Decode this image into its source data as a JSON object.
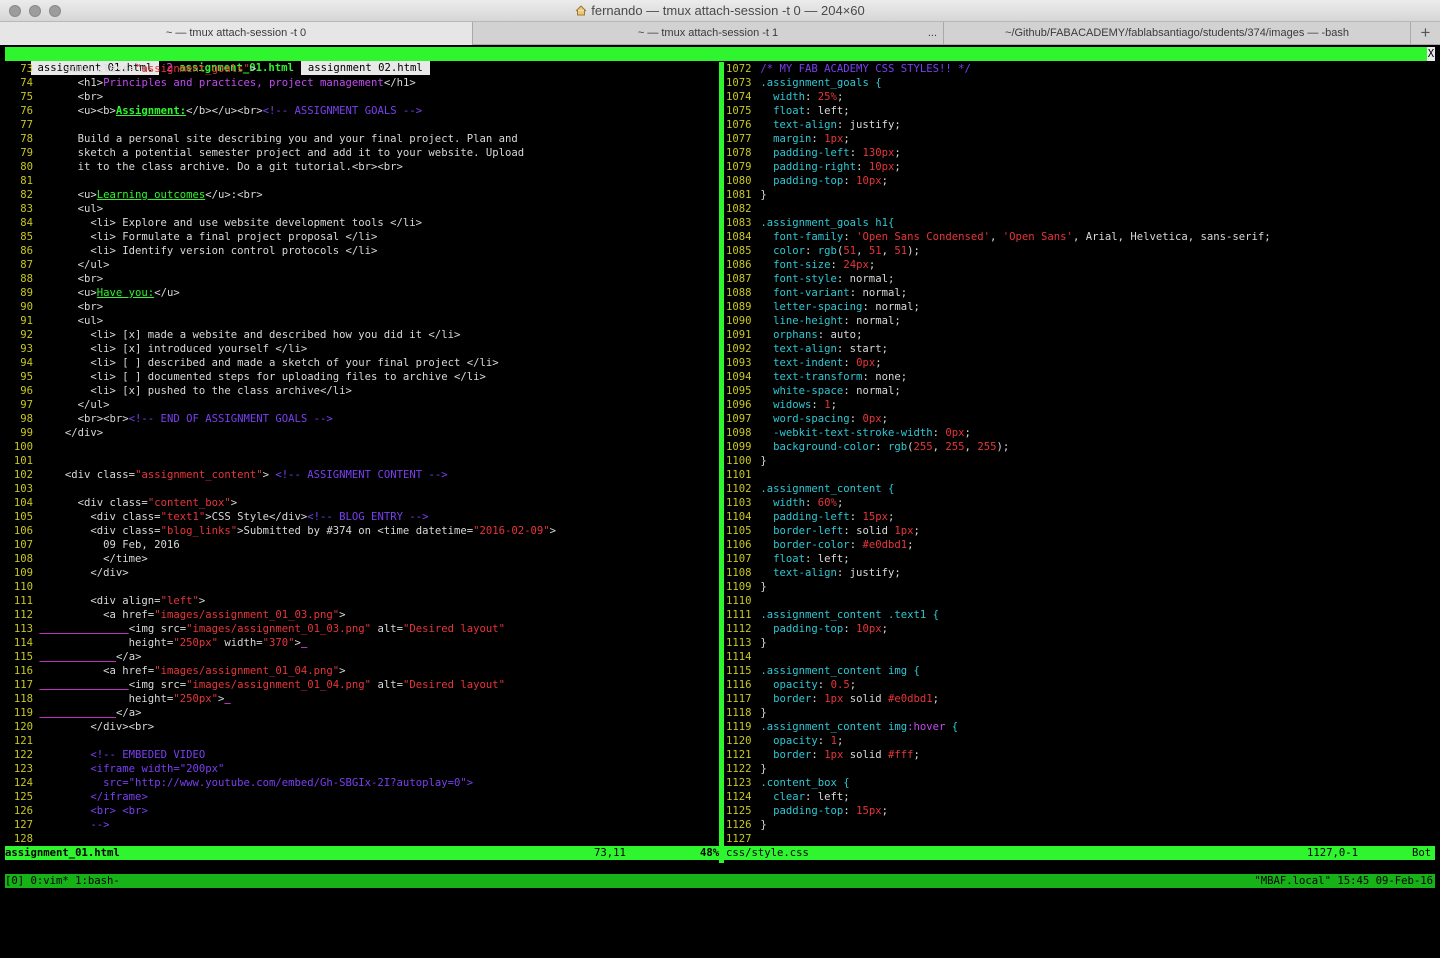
{
  "window": {
    "title": "fernando — tmux attach-session -t 0 — 204×60"
  },
  "tabs": [
    {
      "label": "~ — tmux attach-session -t 0",
      "active": true
    },
    {
      "label": "~ — tmux attach-session -t 1",
      "active": false,
      "extra": "..."
    },
    {
      "label": "~/Github/FABACADEMY/fablabsantiago/students/374/images — -bash",
      "active": false
    }
  ],
  "tab_add": "+",
  "buffers": [
    {
      "label": "assignment 01.html",
      "selected": false
    },
    {
      "num": "2",
      "label": "assignment_01.html",
      "selected": true
    },
    {
      "label": "assignment 02.html",
      "selected": false
    }
  ],
  "buffer_close": "X",
  "left_lines": [
    {
      "n": "73",
      "t": "    <div class=\"assignment_goals\">"
    },
    {
      "n": "74",
      "t": "      <h1>Principles and practices, project management</h1>"
    },
    {
      "n": "75",
      "t": "      <br>"
    },
    {
      "n": "76",
      "t": "      <u><b>Assignment:</b></u><br><!-- ASSIGNMENT GOALS -->"
    },
    {
      "n": "77",
      "t": ""
    },
    {
      "n": "78",
      "t": "      Build a personal site describing you and your final project. Plan and"
    },
    {
      "n": "79",
      "t": "      sketch a potential semester project and add it to your website. Upload"
    },
    {
      "n": "80",
      "t": "      it to the class archive. Do a git tutorial.<br><br>"
    },
    {
      "n": "81",
      "t": ""
    },
    {
      "n": "82",
      "t": "      <u>Learning outcomes</u>:<br>"
    },
    {
      "n": "83",
      "t": "      <ul>"
    },
    {
      "n": "84",
      "t": "        <li> Explore and use website development tools </li>"
    },
    {
      "n": "85",
      "t": "        <li> Formulate a final project proposal </li>"
    },
    {
      "n": "86",
      "t": "        <li> Identify version control protocols </li>"
    },
    {
      "n": "87",
      "t": "      </ul>"
    },
    {
      "n": "88",
      "t": "      <br>"
    },
    {
      "n": "89",
      "t": "      <u>Have you:</u>"
    },
    {
      "n": "90",
      "t": "      <br>"
    },
    {
      "n": "91",
      "t": "      <ul>"
    },
    {
      "n": "92",
      "t": "        <li> [x] made a website and described how you did it </li>"
    },
    {
      "n": "93",
      "t": "        <li> [x] introduced yourself </li>"
    },
    {
      "n": "94",
      "t": "        <li> [ ] described and made a sketch of your final project </li>"
    },
    {
      "n": "95",
      "t": "        <li> [ ] documented steps for uploading files to archive </li>"
    },
    {
      "n": "96",
      "t": "        <li> [x] pushed to the class archive</li>"
    },
    {
      "n": "97",
      "t": "      </ul>"
    },
    {
      "n": "98",
      "t": "      <br><br><!-- END OF ASSIGNMENT GOALS -->"
    },
    {
      "n": "99",
      "t": "    </div>"
    },
    {
      "n": "100",
      "t": ""
    },
    {
      "n": "101",
      "t": ""
    },
    {
      "n": "102",
      "t": "    <div class=\"assignment_content\"> <!-- ASSIGNMENT CONTENT -->"
    },
    {
      "n": "103",
      "t": ""
    },
    {
      "n": "104",
      "t": "      <div class=\"content_box\">"
    },
    {
      "n": "105",
      "t": "        <div class=\"text1\">CSS Style</div><!-- BLOG ENTRY -->"
    },
    {
      "n": "106",
      "t": "        <div class=\"blog_links\">Submitted by #374 on <time datetime=\"2016-02-09\">"
    },
    {
      "n": "107",
      "t": "          09 Feb, 2016"
    },
    {
      "n": "108",
      "t": "          </time>"
    },
    {
      "n": "109",
      "t": "        </div>"
    },
    {
      "n": "110",
      "t": ""
    },
    {
      "n": "111",
      "t": "        <div align=\"left\">"
    },
    {
      "n": "112",
      "t": "          <a href=\"images/assignment_01_03.png\">"
    },
    {
      "n": "113",
      "t": "______________<img src=\"images/assignment_01_03.png\" alt=\"Desired layout\""
    },
    {
      "n": "114",
      "t": "              height=\"250px\" width=\"370\">_"
    },
    {
      "n": "115",
      "t": "____________</a>"
    },
    {
      "n": "116",
      "t": "          <a href=\"images/assignment_01_04.png\">"
    },
    {
      "n": "117",
      "t": "______________<img src=\"images/assignment_01_04.png\" alt=\"Desired layout\""
    },
    {
      "n": "118",
      "t": "              height=\"250px\">_"
    },
    {
      "n": "119",
      "t": "____________</a>"
    },
    {
      "n": "120",
      "t": "        </div><br>"
    },
    {
      "n": "121",
      "t": ""
    },
    {
      "n": "122",
      "t": "        <!-- EMBEDED VIDEO"
    },
    {
      "n": "123",
      "t": "        <iframe width=\"200px\""
    },
    {
      "n": "124",
      "t": "          src=\"http://www.youtube.com/embed/Gh-SBGIx-2I?autoplay=0\">"
    },
    {
      "n": "125",
      "t": "        </iframe>"
    },
    {
      "n": "126",
      "t": "        <br> <br>"
    },
    {
      "n": "127",
      "t": "        -->"
    },
    {
      "n": "128",
      "t": ""
    }
  ],
  "right_lines": [
    {
      "n": "1072",
      "t": "/* MY FAB ACADEMY CSS STYLES!! */"
    },
    {
      "n": "1073",
      "t": ".assignment_goals {"
    },
    {
      "n": "1074",
      "t": "  width: 25%;"
    },
    {
      "n": "1075",
      "t": "  float: left;"
    },
    {
      "n": "1076",
      "t": "  text-align: justify;"
    },
    {
      "n": "1077",
      "t": "  margin: 1px;"
    },
    {
      "n": "1078",
      "t": "  padding-left: 130px;"
    },
    {
      "n": "1079",
      "t": "  padding-right: 10px;"
    },
    {
      "n": "1080",
      "t": "  padding-top: 10px;"
    },
    {
      "n": "1081",
      "t": "}"
    },
    {
      "n": "1082",
      "t": ""
    },
    {
      "n": "1083",
      "t": ".assignment_goals h1{"
    },
    {
      "n": "1084",
      "t": "  font-family: 'Open Sans Condensed', 'Open Sans', Arial, Helvetica, sans-serif;"
    },
    {
      "n": "1085",
      "t": "  color: rgb(51, 51, 51);"
    },
    {
      "n": "1086",
      "t": "  font-size: 24px;"
    },
    {
      "n": "1087",
      "t": "  font-style: normal;"
    },
    {
      "n": "1088",
      "t": "  font-variant: normal;"
    },
    {
      "n": "1089",
      "t": "  letter-spacing: normal;"
    },
    {
      "n": "1090",
      "t": "  line-height: normal;"
    },
    {
      "n": "1091",
      "t": "  orphans: auto;"
    },
    {
      "n": "1092",
      "t": "  text-align: start;"
    },
    {
      "n": "1093",
      "t": "  text-indent: 0px;"
    },
    {
      "n": "1094",
      "t": "  text-transform: none;"
    },
    {
      "n": "1095",
      "t": "  white-space: normal;"
    },
    {
      "n": "1096",
      "t": "  widows: 1;"
    },
    {
      "n": "1097",
      "t": "  word-spacing: 0px;"
    },
    {
      "n": "1098",
      "t": "  -webkit-text-stroke-width: 0px;"
    },
    {
      "n": "1099",
      "t": "  background-color: rgb(255, 255, 255);"
    },
    {
      "n": "1100",
      "t": "}"
    },
    {
      "n": "1101",
      "t": ""
    },
    {
      "n": "1102",
      "t": ".assignment_content {"
    },
    {
      "n": "1103",
      "t": "  width: 60%;"
    },
    {
      "n": "1104",
      "t": "  padding-left: 15px;"
    },
    {
      "n": "1105",
      "t": "  border-left: solid 1px;"
    },
    {
      "n": "1106",
      "t": "  border-color: #e0dbd1;"
    },
    {
      "n": "1107",
      "t": "  float: left;"
    },
    {
      "n": "1108",
      "t": "  text-align: justify;"
    },
    {
      "n": "1109",
      "t": "}"
    },
    {
      "n": "1110",
      "t": ""
    },
    {
      "n": "1111",
      "t": ".assignment_content .text1 {"
    },
    {
      "n": "1112",
      "t": "  padding-top: 10px;"
    },
    {
      "n": "1113",
      "t": "}"
    },
    {
      "n": "1114",
      "t": ""
    },
    {
      "n": "1115",
      "t": ".assignment_content img {"
    },
    {
      "n": "1116",
      "t": "  opacity: 0.5;"
    },
    {
      "n": "1117",
      "t": "  border: 1px solid #e0dbd1;"
    },
    {
      "n": "1118",
      "t": "}"
    },
    {
      "n": "1119",
      "t": ".assignment_content img:hover {"
    },
    {
      "n": "1120",
      "t": "  opacity: 1;"
    },
    {
      "n": "1121",
      "t": "  border: 1px solid #fff;"
    },
    {
      "n": "1122",
      "t": "}"
    },
    {
      "n": "1123",
      "t": ".content_box {"
    },
    {
      "n": "1124",
      "t": "  clear: left;"
    },
    {
      "n": "1125",
      "t": "  padding-top: 15px;"
    },
    {
      "n": "1126",
      "t": "}"
    },
    {
      "n": "1127",
      "t": ""
    }
  ],
  "status": {
    "left_file": "assignment_01.html",
    "left_pos": "73,11",
    "left_pct": "48%",
    "right_file": "css/style.css",
    "right_pos": "1127,0-1",
    "right_pct": "Bot"
  },
  "tmux": {
    "windows": "[0] 0:vim* 1:bash-",
    "right": "\"MBAF.local\" 15:45 09-Feb-16"
  },
  "colors": {
    "vim_green": "#2ef52e",
    "tmux_green": "#17b217",
    "string_red": "#e6353a",
    "comment_purple": "#7a3ff0",
    "line_number_yellow": "#c8c820",
    "selector_cyan": "#2fc7d2"
  }
}
